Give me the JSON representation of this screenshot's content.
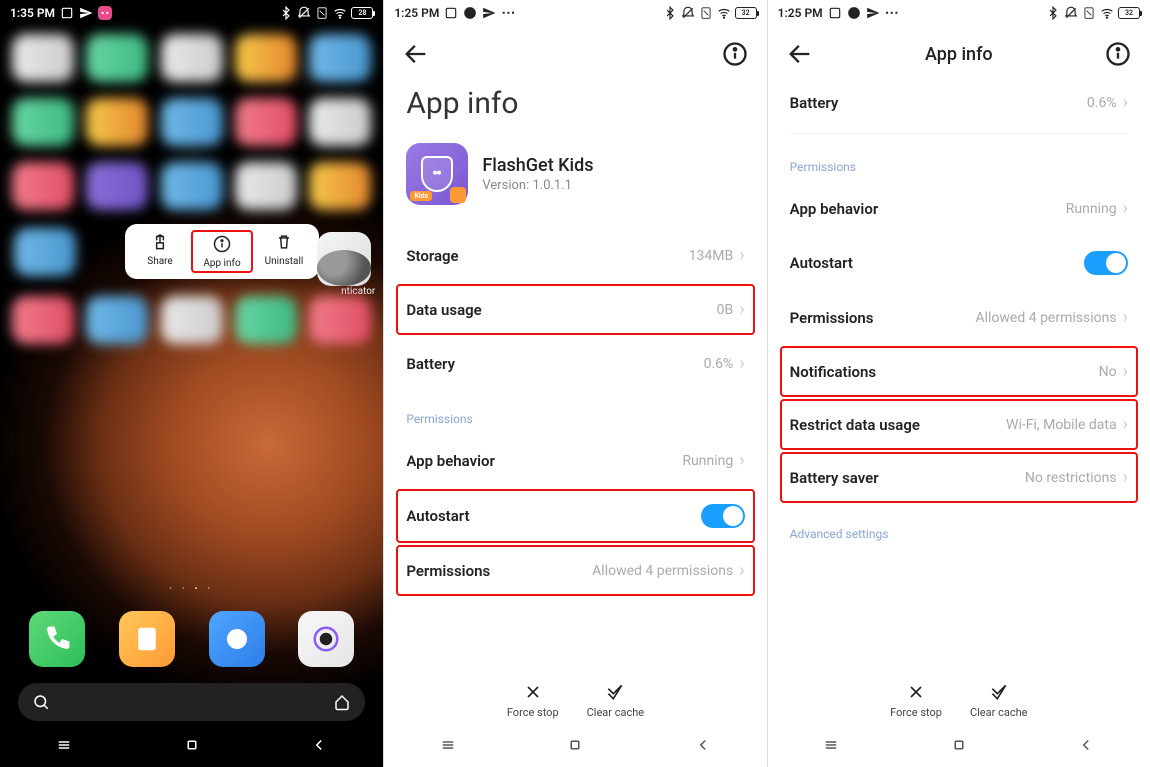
{
  "screen1": {
    "statusbar": {
      "time": "1:35 PM",
      "battery": 28
    },
    "popup": {
      "share": "Share",
      "appinfo": "App info",
      "uninstall": "Uninstall"
    },
    "visible_icon_label": "nticator"
  },
  "screen2": {
    "statusbar": {
      "time": "1:25 PM",
      "battery": 32
    },
    "title": "App info",
    "app": {
      "name": "FlashGet Kids",
      "version": "Version: 1.0.1.1",
      "icon_badge": "Kids"
    },
    "rows": {
      "storage": {
        "label": "Storage",
        "value": "134MB"
      },
      "data_usage": {
        "label": "Data usage",
        "value": "0B"
      },
      "battery": {
        "label": "Battery",
        "value": "0.6%"
      },
      "section": "Permissions",
      "app_behavior": {
        "label": "App behavior",
        "value": "Running"
      },
      "autostart": {
        "label": "Autostart"
      },
      "permissions": {
        "label": "Permissions",
        "value": "Allowed 4 permissions"
      }
    },
    "actions": {
      "force_stop": "Force stop",
      "clear_cache": "Clear cache"
    }
  },
  "screen3": {
    "statusbar": {
      "time": "1:25 PM",
      "battery": 32
    },
    "title": "App info",
    "rows": {
      "battery": {
        "label": "Battery",
        "value": "0.6%"
      },
      "section": "Permissions",
      "app_behavior": {
        "label": "App behavior",
        "value": "Running"
      },
      "autostart": {
        "label": "Autostart"
      },
      "permissions": {
        "label": "Permissions",
        "value": "Allowed 4 permissions"
      },
      "notifications": {
        "label": "Notifications",
        "value": "No"
      },
      "restrict_data": {
        "label": "Restrict data usage",
        "value": "Wi-Fi, Mobile data"
      },
      "battery_saver": {
        "label": "Battery saver",
        "value": "No restrictions"
      },
      "advanced": "Advanced settings"
    },
    "actions": {
      "force_stop": "Force stop",
      "clear_cache": "Clear cache"
    }
  }
}
